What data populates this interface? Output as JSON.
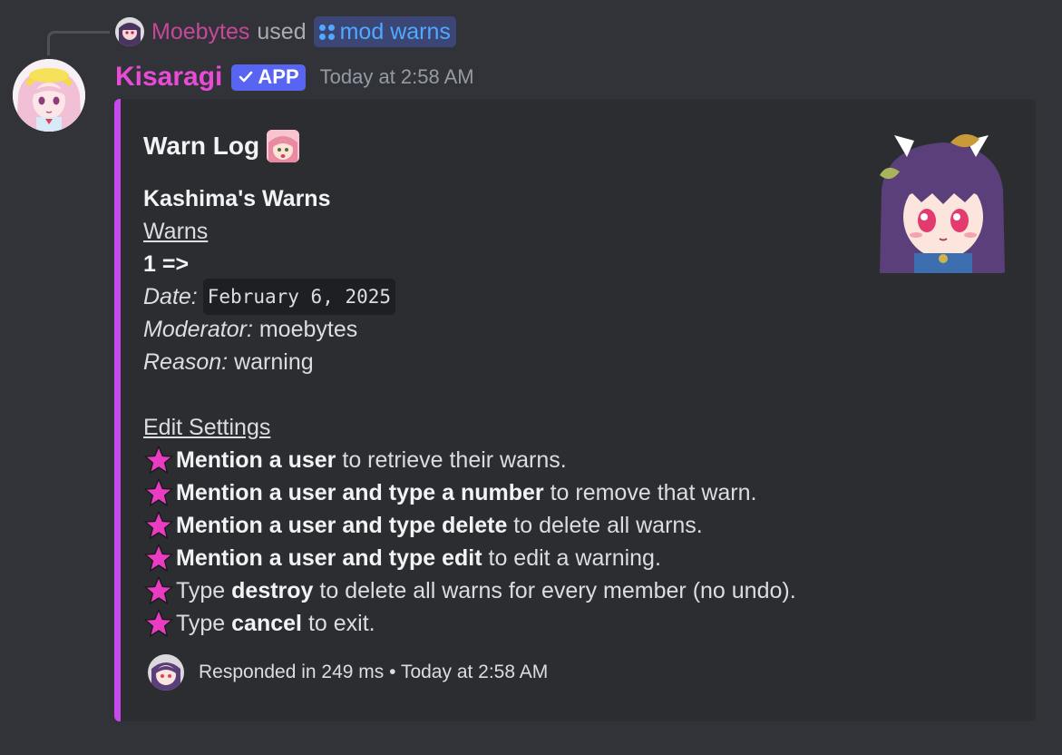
{
  "reply": {
    "user": "Moebytes",
    "used_word": "used",
    "command": "mod warns"
  },
  "message": {
    "author": "Kisaragi",
    "badge": "APP",
    "timestamp": "Today at 2:58 AM"
  },
  "embed": {
    "accent_color": "#c64bea",
    "title": "Warn Log",
    "heading": "Kashima's Warns",
    "section_warns": "Warns",
    "warn_index": "1 =>",
    "date_label": "Date:",
    "date_value": "February 6, 2025",
    "moderator_label": "Moderator:",
    "moderator_value": "moebytes",
    "reason_label": "Reason:",
    "reason_value": "warning",
    "section_settings": "Edit Settings",
    "settings": [
      {
        "bold": "Mention a user",
        "rest": " to retrieve their warns."
      },
      {
        "bold": "Mention a user and type a number",
        "rest": " to remove that warn."
      },
      {
        "bold": "Mention a user and type delete",
        "rest": " to delete all warns."
      },
      {
        "bold": "Mention a user and type edit",
        "rest": " to edit a warning."
      },
      {
        "pre": "Type ",
        "bold": "destroy",
        "rest": " to delete all warns for every member (no undo)."
      },
      {
        "pre": "Type ",
        "bold": "cancel",
        "rest": " to exit."
      }
    ],
    "footer": "Responded in 249 ms • Today at 2:58 AM"
  },
  "icons": {
    "star": "star-emoji-icon",
    "command": "slash-command-icon",
    "checkmark": "verified-check-icon"
  }
}
